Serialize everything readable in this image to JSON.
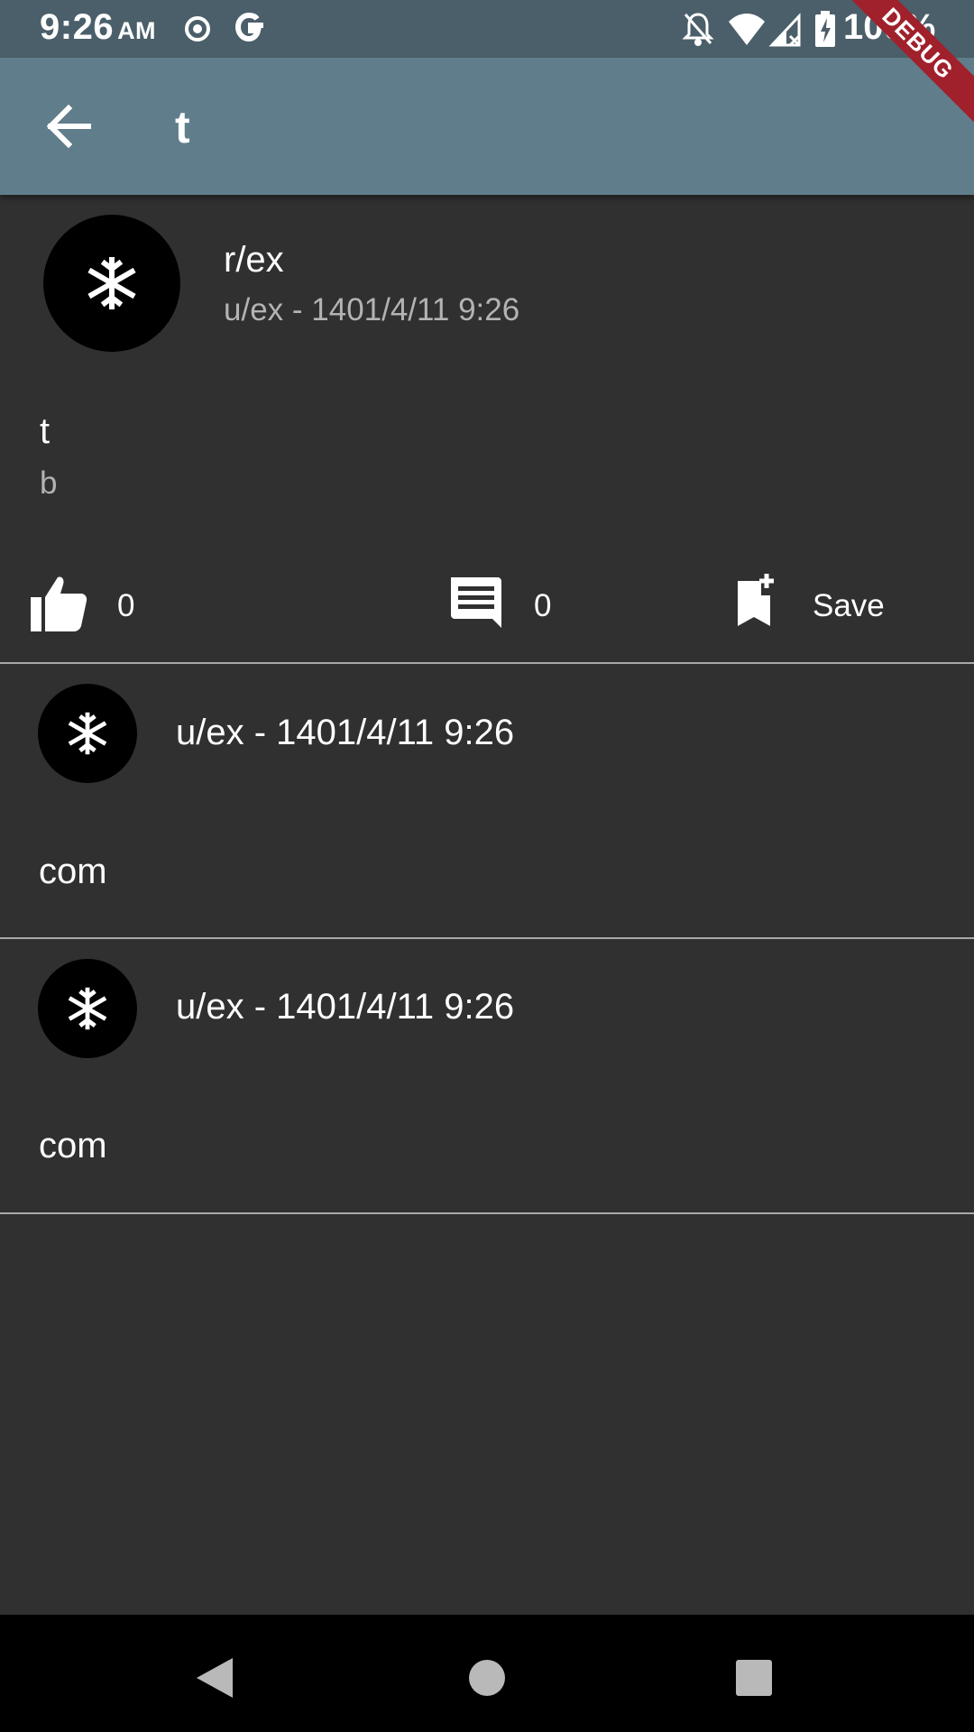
{
  "status_bar": {
    "time": "9:26",
    "ampm": "AM",
    "battery": "100%",
    "debug_label": "DEBUG"
  },
  "app_bar": {
    "title": "t"
  },
  "post": {
    "subreddit": "r/ex",
    "meta": "u/ex - 1401/4/11 9:26",
    "title": "t",
    "body": "b",
    "upvotes": "0",
    "comment_count": "0",
    "save_label": "Save"
  },
  "comments": [
    {
      "meta": "u/ex - 1401/4/11 9:26",
      "body": "com"
    },
    {
      "meta": "u/ex - 1401/4/11 9:26",
      "body": "com"
    }
  ],
  "icons": {
    "back": "arrow-back-icon",
    "avatar": "snowflake-icon",
    "upvote": "thumb-up-icon",
    "comment": "comment-icon",
    "save": "bookmark-add-icon"
  },
  "colors": {
    "app_bar": "#607d8b",
    "status_bar": "#4b5f6a",
    "background": "#303030",
    "debug_banner": "#a0202c"
  }
}
